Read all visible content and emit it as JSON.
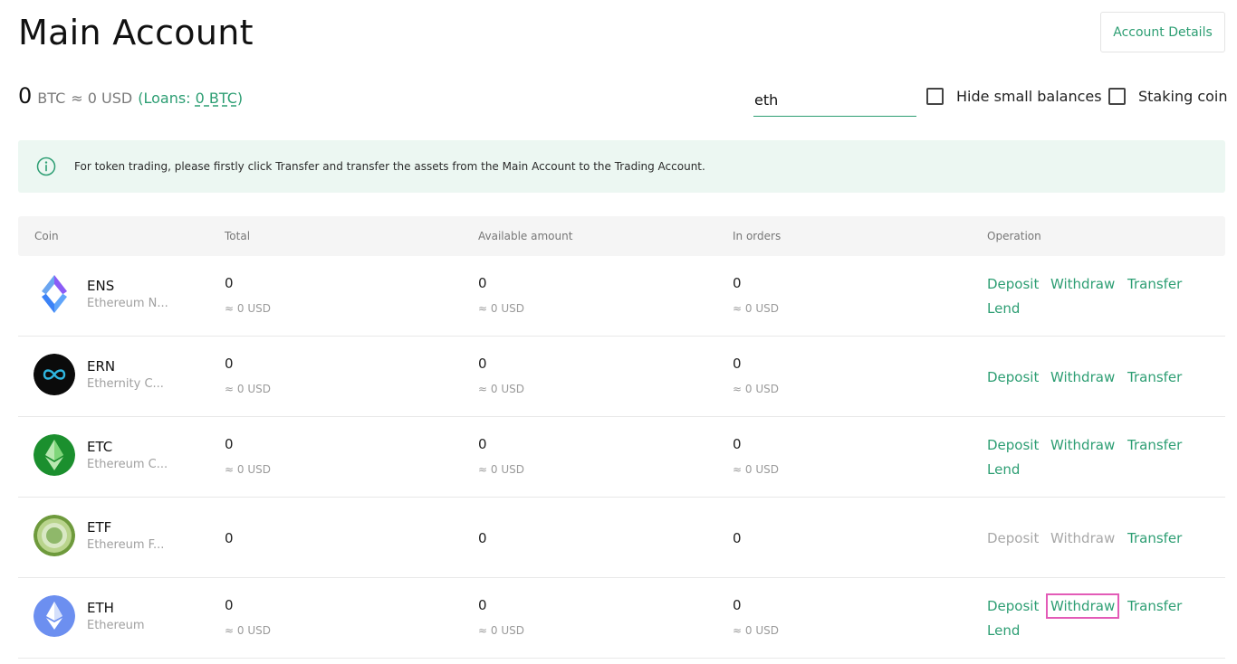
{
  "header": {
    "title": "Main Account",
    "account_details_label": "Account Details"
  },
  "balance": {
    "amount": "0",
    "unit": "BTC",
    "approx": "≈ 0 USD",
    "loans_prefix": "(Loans: ",
    "loans_value": "0 BTC",
    "loans_suffix": ")"
  },
  "search": {
    "value": "eth"
  },
  "filters": {
    "hide_small_label": "Hide small balances",
    "hide_small_checked": false,
    "staking_label": "Staking coin",
    "staking_checked": false
  },
  "notice": {
    "icon": "info-icon",
    "text": "For token trading, please firstly click Transfer and transfer the assets from the Main Account to the Trading Account."
  },
  "table": {
    "headers": [
      "Coin",
      "Total",
      "Available amount",
      "In orders",
      "Operation"
    ],
    "rows": [
      {
        "symbol": "ENS",
        "name": "Ethereum N...",
        "icon": "ens-logo-icon",
        "total": "0",
        "total_usd": "≈ 0 USD",
        "available": "0",
        "available_usd": "≈ 0 USD",
        "in_orders": "0",
        "in_orders_usd": "≈ 0 USD",
        "ops": {
          "deposit": "Deposit",
          "withdraw": "Withdraw",
          "transfer": "Transfer",
          "lend": "Lend"
        }
      },
      {
        "symbol": "ERN",
        "name": "Ethernity C...",
        "icon": "ern-logo-icon",
        "total": "0",
        "total_usd": "≈ 0 USD",
        "available": "0",
        "available_usd": "≈ 0 USD",
        "in_orders": "0",
        "in_orders_usd": "≈ 0 USD",
        "ops": {
          "deposit": "Deposit",
          "withdraw": "Withdraw",
          "transfer": "Transfer"
        }
      },
      {
        "symbol": "ETC",
        "name": "Ethereum C...",
        "icon": "etc-logo-icon",
        "total": "0",
        "total_usd": "≈ 0 USD",
        "available": "0",
        "available_usd": "≈ 0 USD",
        "in_orders": "0",
        "in_orders_usd": "≈ 0 USD",
        "ops": {
          "deposit": "Deposit",
          "withdraw": "Withdraw",
          "transfer": "Transfer",
          "lend": "Lend"
        }
      },
      {
        "symbol": "ETF",
        "name": "Ethereum F...",
        "icon": "etf-logo-icon",
        "total": "0",
        "available": "0",
        "in_orders": "0",
        "ops": {
          "deposit": "Deposit",
          "withdraw": "Withdraw",
          "transfer": "Transfer"
        },
        "deposit_disabled": true,
        "withdraw_disabled": true
      },
      {
        "symbol": "ETH",
        "name": "Ethereum",
        "icon": "eth-logo-icon",
        "total": "0",
        "total_usd": "≈ 0 USD",
        "available": "0",
        "available_usd": "≈ 0 USD",
        "in_orders": "0",
        "in_orders_usd": "≈ 0 USD",
        "ops": {
          "deposit": "Deposit",
          "withdraw": "Withdraw",
          "transfer": "Transfer",
          "lend": "Lend"
        },
        "withdraw_highlighted": true
      }
    ]
  },
  "colors": {
    "accent": "#2d9e73",
    "notice_bg": "#ecf7f2",
    "highlight": "#e35bb7",
    "disabled": "#a8a8a8"
  }
}
